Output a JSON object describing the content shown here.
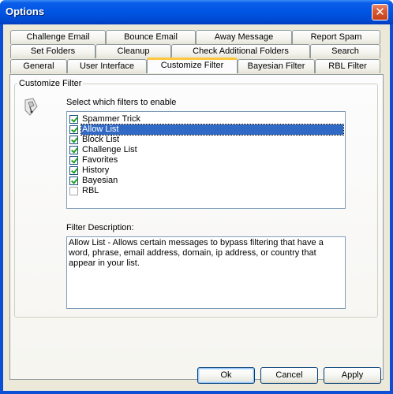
{
  "window": {
    "title": "Options",
    "close_glyph": "✕"
  },
  "tabs": {
    "row1": [
      "Challenge Email",
      "Bounce Email",
      "Away Message",
      "Report Spam"
    ],
    "row2": [
      "Set Folders",
      "Cleanup",
      "Check Additional Folders",
      "Search"
    ],
    "row3": [
      "General",
      "User Interface",
      "Customize Filter",
      "Bayesian Filter",
      "RBL Filter"
    ],
    "active": "Customize Filter"
  },
  "panel": {
    "group_title": "Customize Filter",
    "icon": "filter-icon",
    "select_label": "Select which filters to enable",
    "filters": [
      {
        "label": "Spammer Trick",
        "checked": true
      },
      {
        "label": "Allow List",
        "checked": true,
        "selected": true
      },
      {
        "label": "Block List",
        "checked": true
      },
      {
        "label": "Challenge List",
        "checked": true
      },
      {
        "label": "Favorites",
        "checked": true
      },
      {
        "label": "History",
        "checked": true
      },
      {
        "label": "Bayesian",
        "checked": true
      },
      {
        "label": "RBL",
        "checked": false
      }
    ],
    "description_label": "Filter Description:",
    "description_text": "Allow List - Allows certain messages to bypass filtering that have a word, phrase, email address, domain, ip address, or country that appear in your list."
  },
  "buttons": {
    "ok": "Ok",
    "cancel": "Cancel",
    "apply": "Apply"
  },
  "colors": {
    "titlebar": "#0054e3",
    "selection": "#316ac5",
    "tab_highlight": "#ffc73c",
    "dialog_bg": "#ece9d8"
  }
}
